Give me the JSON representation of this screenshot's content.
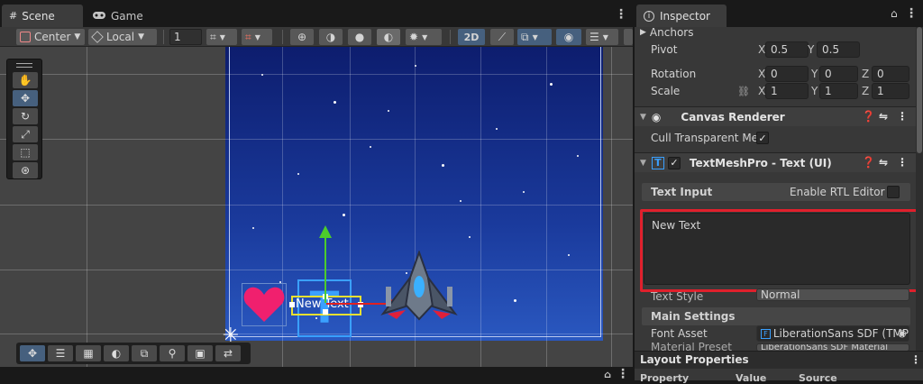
{
  "scene_window": {
    "tabs": [
      {
        "label": "Scene",
        "icon": "grid-icon"
      },
      {
        "label": "Game",
        "icon": "gamepad-icon"
      }
    ],
    "toolbar": {
      "pivot_mode": "Center",
      "pivot_rotation": "Local",
      "grid_snap_value": "1",
      "mode_2d_label": "2D"
    },
    "scene_objects": {
      "text_label": "New Text"
    }
  },
  "inspector": {
    "title": "Inspector",
    "rect_transform": {
      "anchors_label": "Anchors",
      "pivot_label": "Pivot",
      "pivot_x": "0.5",
      "pivot_y": "0.5",
      "rotation_label": "Rotation",
      "rotation": {
        "x": "0",
        "y": "0",
        "z": "0"
      },
      "scale_label": "Scale",
      "scale": {
        "x": "1",
        "y": "1",
        "z": "1"
      },
      "axis_x": "X",
      "axis_y": "Y",
      "axis_z": "Z"
    },
    "canvas_renderer": {
      "title": "Canvas Renderer",
      "cull_label": "Cull Transparent Mes",
      "cull_checked": "✓"
    },
    "textmeshpro": {
      "title": "TextMeshPro - Text (UI)",
      "enabled_check": "✓",
      "text_input_label": "Text Input",
      "enable_rtl_label": "Enable RTL Editor",
      "text_value": "New Text",
      "text_style_label": "Text Style",
      "text_style_value": "Normal",
      "main_settings_label": "Main Settings",
      "font_asset_label": "Font Asset",
      "font_asset_value": "LiberationSans SDF (TMP",
      "material_preset_label": "Material Preset",
      "material_preset_value": "LiberationSans SDF Material"
    },
    "layout_properties": {
      "title": "Layout Properties",
      "columns": [
        "Property",
        "Value",
        "Source"
      ]
    }
  },
  "colors": {
    "highlight": "#e0202c",
    "accent_blue": "#3a72c4",
    "heart": "#f0206e"
  }
}
